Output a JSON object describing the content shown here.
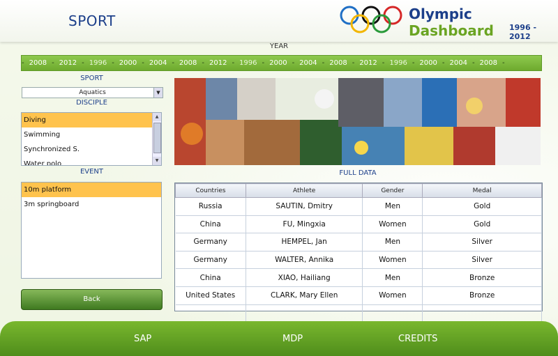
{
  "header": {
    "page_title": "SPORT",
    "brand_word1": "Olympic",
    "brand_word2": "Dashboard",
    "brand_years": "1996 - 2012"
  },
  "year": {
    "label": "YEAR",
    "items": [
      "2008",
      "2012",
      "1996",
      "2000",
      "2004",
      "2008",
      "2012",
      "1996",
      "2000",
      "2004",
      "2008",
      "2012",
      "1996",
      "2000",
      "2004",
      "2008"
    ]
  },
  "sport": {
    "label": "SPORT",
    "selected": "Aquatics"
  },
  "disciple": {
    "label": "DISCIPLE",
    "items": [
      "Diving",
      "Swimming",
      "Synchronized S.",
      "Water polo"
    ],
    "selected": "Diving"
  },
  "event": {
    "label": "EVENT",
    "items": [
      "10m platform",
      "3m springboard"
    ],
    "selected": "10m platform"
  },
  "back_label": "Back",
  "full_data": {
    "label": "FULL DATA",
    "columns": [
      "Countries",
      "Athlete",
      "Gender",
      "Medal"
    ],
    "rows": [
      [
        "Russia",
        "SAUTIN, Dmitry",
        "Men",
        "Gold"
      ],
      [
        "China",
        "FU, Mingxia",
        "Women",
        "Gold"
      ],
      [
        "Germany",
        "HEMPEL, Jan",
        "Men",
        "Silver"
      ],
      [
        "Germany",
        "WALTER, Annika",
        "Women",
        "Silver"
      ],
      [
        "China",
        "XIAO, Hailiang",
        "Men",
        "Bronze"
      ],
      [
        "United States",
        "CLARK, Mary Ellen",
        "Women",
        "Bronze"
      ],
      [
        "",
        "",
        "",
        ""
      ]
    ]
  },
  "footer": {
    "nav1": "SAP",
    "nav2": "MDP",
    "nav3": "CREDITS"
  },
  "colors": {
    "accent_green": "#6eaa2e",
    "title_blue": "#1c3f8a",
    "selection": "#ffc34d"
  }
}
